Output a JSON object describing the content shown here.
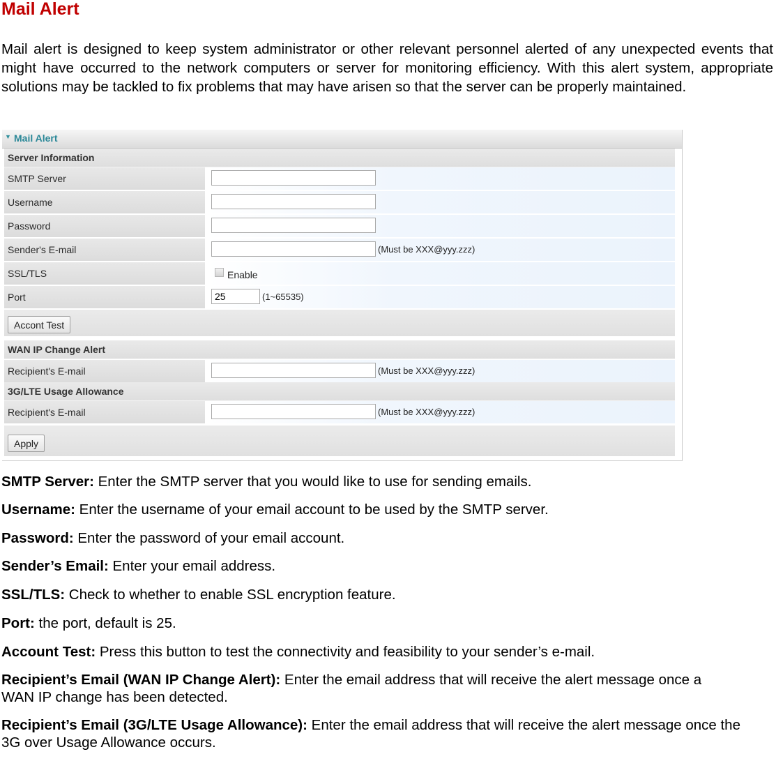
{
  "doc": {
    "title": "Mail Alert",
    "intro": "Mail alert is designed to keep system administrator or other relevant personnel alerted of any unexpected events that might have occurred to the network computers or server for monitoring efficiency. With this alert system, appropriate solutions may be tackled to fix problems that may have arisen so that the server can be properly maintained."
  },
  "panel": {
    "title": "Mail Alert",
    "sections": {
      "server_info": "Server Information",
      "wan_ip": "WAN IP Change Alert",
      "lte": "3G/LTE Usage Allowance"
    },
    "fields": {
      "smtp_server": {
        "label": "SMTP Server",
        "value": ""
      },
      "username": {
        "label": "Username",
        "value": ""
      },
      "password": {
        "label": "Password",
        "value": ""
      },
      "sender_email": {
        "label": "Sender's E-mail",
        "value": "",
        "hint": "(Must be XXX@yyy.zzz)"
      },
      "ssl_tls": {
        "label": "SSL/TLS",
        "checkbox_label": "Enable",
        "checked": false
      },
      "port": {
        "label": "Port",
        "value": "25",
        "hint": "(1~65535)"
      },
      "wan_recipient": {
        "label": "Recipient's E-mail",
        "value": "",
        "hint": "(Must be XXX@yyy.zzz)"
      },
      "lte_recipient": {
        "label": "Recipient's E-mail",
        "value": "",
        "hint": "(Must be XXX@yyy.zzz)"
      }
    },
    "buttons": {
      "account_test": "Accont Test",
      "apply": "Apply"
    }
  },
  "descriptions": [
    {
      "term": "SMTP Server:",
      "text": " Enter the SMTP server that you would like to use for sending emails."
    },
    {
      "term": "Username:",
      "text": " Enter the username of your email account to be used by the SMTP server."
    },
    {
      "term": "Password:",
      "text": " Enter the password of your email account."
    },
    {
      "term": "Sender’s Email:",
      "text": " Enter your email address."
    },
    {
      "term": "SSL/TLS:",
      "text": " Check to whether to enable SSL encryption feature."
    },
    {
      "term": "Port:",
      "text": " the port, default is 25."
    },
    {
      "term": "Account Test:",
      "text": " Press this button to test the connectivity and feasibility to your sender’s e-mail."
    },
    {
      "term": "Recipient’s Email (WAN IP Change Alert):",
      "text": " Enter the email address that will receive the alert message once a WAN IP change has been detected."
    },
    {
      "term": "Recipient’s Email (3G/LTE Usage Allowance):",
      "text": " Enter the email address that will receive the alert message once the 3G over Usage Allowance occurs."
    }
  ]
}
